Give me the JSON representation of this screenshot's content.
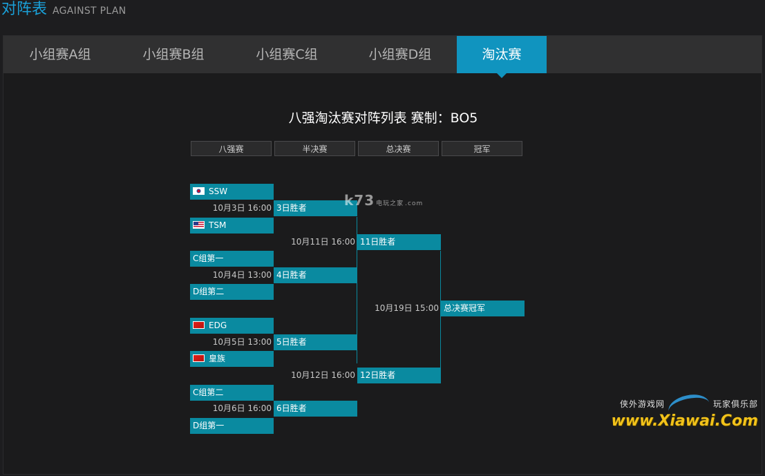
{
  "header": {
    "title": "对阵表",
    "subtitle": "AGAINST PLAN"
  },
  "tabs": [
    {
      "label": "小组赛A组",
      "active": false
    },
    {
      "label": "小组赛B组",
      "active": false
    },
    {
      "label": "小组赛C组",
      "active": false
    },
    {
      "label": "小组赛D组",
      "active": false
    },
    {
      "label": "淘汰赛",
      "active": true
    }
  ],
  "bracket": {
    "title": "八强淘汰赛对阵列表 赛制：BO5",
    "rounds": [
      "八强赛",
      "半决赛",
      "总决赛",
      "冠军"
    ],
    "quarterfinals": [
      {
        "team1": "SSW",
        "flag1": "kr-flag-icon",
        "team2": "TSM",
        "flag2": "us-flag-icon",
        "time": "10月3日 16:00",
        "winner": "3日胜者"
      },
      {
        "team1": "C组第一",
        "flag1": "",
        "team2": "D组第二",
        "flag2": "",
        "time": "10月4日 13:00",
        "winner": "4日胜者"
      },
      {
        "team1": "EDG",
        "flag1": "cn-flag-icon",
        "team2": "皇族",
        "flag2": "cn-flag-icon",
        "time": "10月5日 13:00",
        "winner": "5日胜者"
      },
      {
        "team1": "C组第二",
        "flag1": "",
        "team2": "D组第一",
        "flag2": "",
        "time": "10月6日 16:00",
        "winner": "6日胜者"
      }
    ],
    "semifinals": [
      {
        "time": "10月11日 16:00",
        "winner": "11日胜者"
      },
      {
        "time": "10月12日 16:00",
        "winner": "12日胜者"
      }
    ],
    "final": {
      "time": "10月19日 15:00",
      "winner": "总决赛冠军"
    }
  },
  "watermarks": {
    "k73": "k73",
    "k73_sub": "电玩之家",
    "k73_domain": ".com",
    "xiawai_left": "侠外游戏网",
    "xiawai_right": "玩家俱乐部",
    "xiawai_url": "www.Xiawai.Com"
  },
  "colors": {
    "accent": "#1094bf",
    "slot": "#0a8aa0",
    "title": "#1aa0d8",
    "background": "#1d1d1f"
  }
}
